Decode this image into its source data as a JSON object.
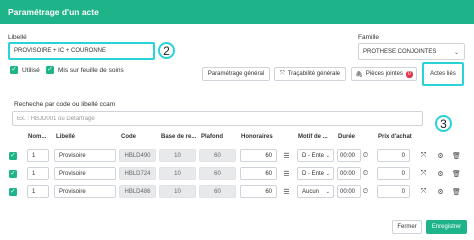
{
  "window": {
    "title": "Paramétrage d'un acte"
  },
  "form": {
    "libelle_label": "Libellé",
    "libelle_value": "PROVISOIRE + IC + COURONNE",
    "famille_label": "Famille",
    "famille_value": "PROTHESE CONJOINTES",
    "utilise_label": "Utilisé",
    "feuille_label": "Mis sur feuille de soins",
    "search_label": "Recheche par code ou libellé ccam",
    "search_placeholder": "Ex. : HBJD001 ou Détartrage"
  },
  "annotations": {
    "first": "2",
    "second": "3"
  },
  "buttons": {
    "parametrage": "Paramétrage général",
    "tracabilite": "Traçabilité générale",
    "pieces": "Pièces jointes",
    "pieces_count": "0",
    "actes_lies": "Actes liés",
    "fermer": "Fermer",
    "enregistrer": "Enregistrer"
  },
  "table": {
    "headers": {
      "nombre": "Nom...",
      "libelle": "Libellé",
      "code": "Code",
      "base": "Base de re...",
      "plafond": "Plafond",
      "honoraires": "Honoraires",
      "motif": "Motif de ...",
      "duree": "Durée",
      "prix": "Prix d'achat"
    },
    "rows": [
      {
        "nombre": "1",
        "libelle": "Provisoire",
        "code": "HBLD490",
        "base": "10",
        "plafond": "60",
        "honoraires": "60",
        "motif": "D - Ente",
        "duree": "00:00",
        "prix": "0"
      },
      {
        "nombre": "1",
        "libelle": "Provisoire",
        "code": "HBLD724",
        "base": "10",
        "plafond": "60",
        "honoraires": "60",
        "motif": "D - Ente",
        "duree": "00:00",
        "prix": "0"
      },
      {
        "nombre": "1",
        "libelle": "Provisoire",
        "code": "HBLD486",
        "base": "10",
        "plafond": "60",
        "honoraires": "60",
        "motif": "Aucun",
        "duree": "00:00",
        "prix": "0"
      }
    ]
  },
  "colors": {
    "accent": "#1fb389",
    "highlight": "#2ad3d8",
    "badge": "#e1374b"
  },
  "icons": [
    "list-icon",
    "dropdown-arrow-icon",
    "clock-icon",
    "expand-icon",
    "gear-icon",
    "trash-icon",
    "paperclip-icon",
    "checkmark-icon"
  ]
}
